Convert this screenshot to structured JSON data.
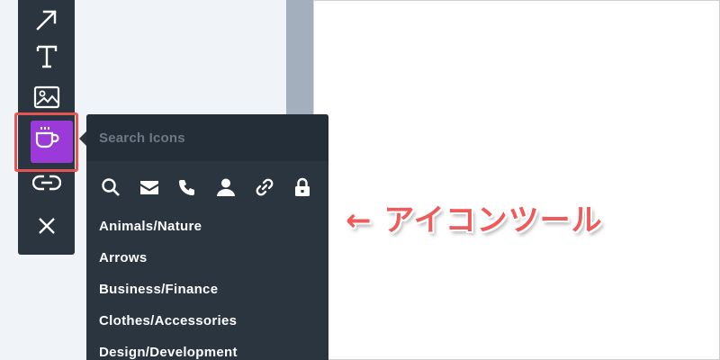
{
  "toolbar": {
    "tools": [
      {
        "id": "arrow",
        "icon": "arrow-diagonal-icon",
        "active": false
      },
      {
        "id": "text",
        "icon": "text-t-icon",
        "active": false
      },
      {
        "id": "image",
        "icon": "image-icon",
        "active": false
      },
      {
        "id": "icon",
        "icon": "coffee-cup-icon",
        "active": true
      },
      {
        "id": "link",
        "icon": "link-icon",
        "active": false
      },
      {
        "id": "close",
        "icon": "close-icon",
        "active": false
      }
    ],
    "active_color": "#9b3ad9",
    "highlight_color": "#e75454"
  },
  "icon_panel": {
    "search": {
      "placeholder": "Search Icons",
      "value": ""
    },
    "quick_icons": [
      "search-icon",
      "envelope-icon",
      "phone-icon",
      "user-icon",
      "link-icon",
      "lock-icon"
    ],
    "categories": [
      "Animals/Nature",
      "Arrows",
      "Business/Finance",
      "Clothes/Accessories",
      "Design/Development"
    ],
    "background_color": "#2a3540"
  },
  "annotation": {
    "text": "← アイコンツール",
    "color": "#ef5a5a"
  }
}
